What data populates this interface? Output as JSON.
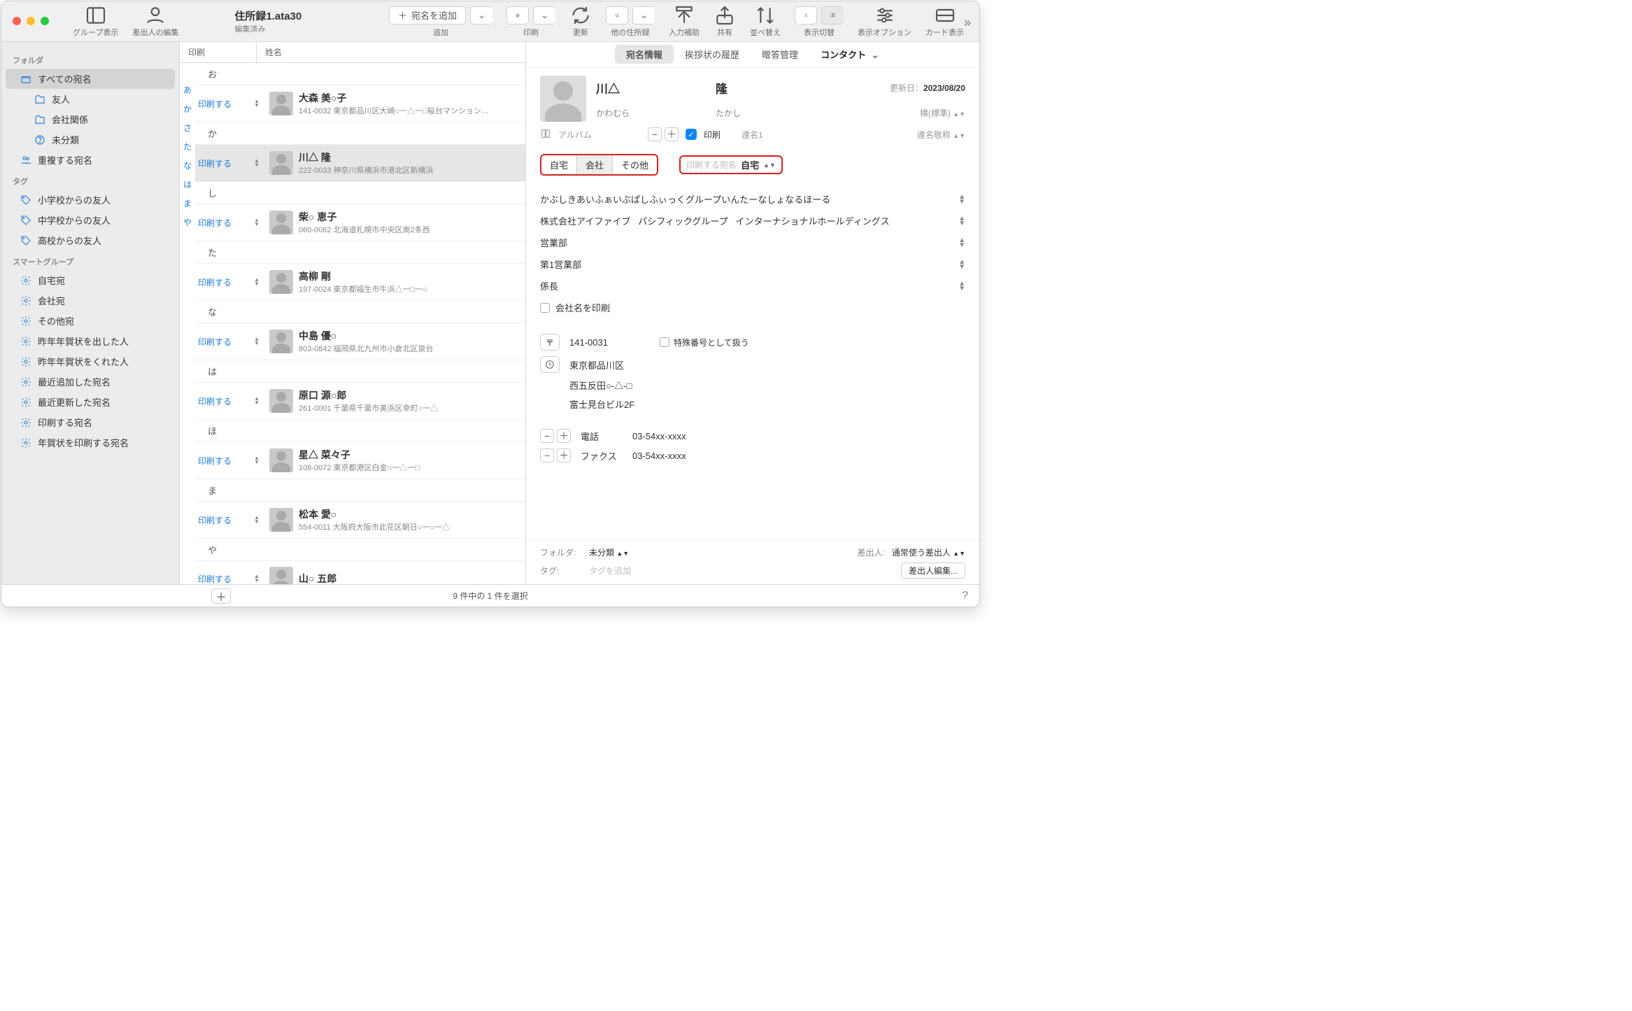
{
  "title": "住所録1.ata30",
  "subtitle": "編集済み",
  "toolbar": {
    "group_view": "グループ表示",
    "sender_edit": "差出人の編集",
    "add_addressee": "宛名を追加",
    "add": "追加",
    "print": "印刷",
    "refresh": "更新",
    "other_books": "他の住所録",
    "input_assist": "入力補助",
    "share": "共有",
    "sort": "並べ替え",
    "view_switch": "表示切替",
    "view_options": "表示オプション",
    "card_view": "カード表示"
  },
  "sidebar": {
    "folder_h": "フォルダ",
    "all": "すべての宛名",
    "friends": "友人",
    "company": "会社関係",
    "unclassified": "未分類",
    "duplicates": "重複する宛名",
    "tag_h": "タグ",
    "tag1": "小学校からの友人",
    "tag2": "中学校からの友人",
    "tag3": "高校からの友人",
    "smart_h": "スマートグループ",
    "s1": "自宅宛",
    "s2": "会社宛",
    "s3": "その他宛",
    "s4": "昨年年賀状を出した人",
    "s5": "昨年年賀状をくれた人",
    "s6": "最近追加した宛名",
    "s7": "最近更新した宛名",
    "s8": "印刷する宛名",
    "s9": "年賀状を印刷する宛名"
  },
  "listcols": {
    "print": "印刷",
    "name": "姓名"
  },
  "print_label": "印刷する",
  "kana": [
    "あ",
    "か",
    "さ",
    "た",
    "な",
    "は",
    "ま",
    "や"
  ],
  "groups": {
    "o": "お",
    "ka": "か",
    "shi": "し",
    "ta": "た",
    "na": "な",
    "ha": "は",
    "ho": "ほ",
    "ma": "ま",
    "ya": "や"
  },
  "rows": [
    {
      "name": "大森 美○子",
      "addr": "141-0032 東京都品川区大崎○一△一□桜台マンション…"
    },
    {
      "name": "川△ 隆",
      "addr": "222-0033 神奈川県横浜市港北区新横浜"
    },
    {
      "name": "柴○ 恵子",
      "addr": "060-0062 北海道札幌市中央区南2条西"
    },
    {
      "name": "高柳 剛",
      "addr": "197-0024 東京都福生市牛浜△一□一○"
    },
    {
      "name": "中島 優○",
      "addr": "803-0842 福岡県北九州市小倉北区泉台"
    },
    {
      "name": "原口 源○郎",
      "addr": "261-0001 千葉県千葉市美浜区幸町○一△"
    },
    {
      "name": "星△ 菜々子",
      "addr": "108-0072 東京都港区白金○一△一□"
    },
    {
      "name": "松本 愛○",
      "addr": "554-0011 大阪府大阪市此花区朝日○一○一△"
    },
    {
      "name": "山○ 五郎",
      "addr": ""
    }
  ],
  "dtabs": {
    "info": "宛名情報",
    "history": "挨拶状の履歴",
    "gift": "贈答管理",
    "contact": "コンタクト"
  },
  "card": {
    "sur": "川△",
    "given": "隆",
    "sur_k": "かわむら",
    "given_k": "たかし",
    "updated_lbl": "更新日：",
    "updated": "2023/08/20",
    "orient": "横(標準)",
    "album": "アルバム",
    "print": "印刷",
    "joint1": "連名1",
    "joint_title": "連名敬称"
  },
  "segs": {
    "home": "自宅",
    "office": "会社",
    "other": "その他"
  },
  "dest_lbl": "印刷する宛名",
  "dest_val": "自宅",
  "company": {
    "l1": "かぶしきあいふぁいぶぱしふぃっくグループいんたーなしょなるほーる",
    "l2_a": "株式会社アイファイブ",
    "l2_b": "パシフィックグループ",
    "l2_c": "インターナショナルホールディングス",
    "l3": "営業部",
    "l4": "第1営業部",
    "l5": "係長",
    "printname": "会社名を印刷"
  },
  "address": {
    "zip": "141-0031",
    "special": "特殊番号として扱う",
    "a1": "東京都品川区",
    "a2": "西五反田○-△-□",
    "a3": "富士見台ビル2F"
  },
  "phone": {
    "tel_lbl": "電話",
    "tel": "03-54xx-xxxx",
    "fax_lbl": "ファクス",
    "fax": "03-54xx-xxxx"
  },
  "dfoot": {
    "folder_k": "フォルダ:",
    "folder_v": "未分類",
    "sender_k": "差出人:",
    "sender_v": "通常使う差出人",
    "tag_k": "タグ:",
    "tag_ph": "タグを追加",
    "edit_btn": "差出人編集..."
  },
  "status": "9 件中の 1 件を選択"
}
